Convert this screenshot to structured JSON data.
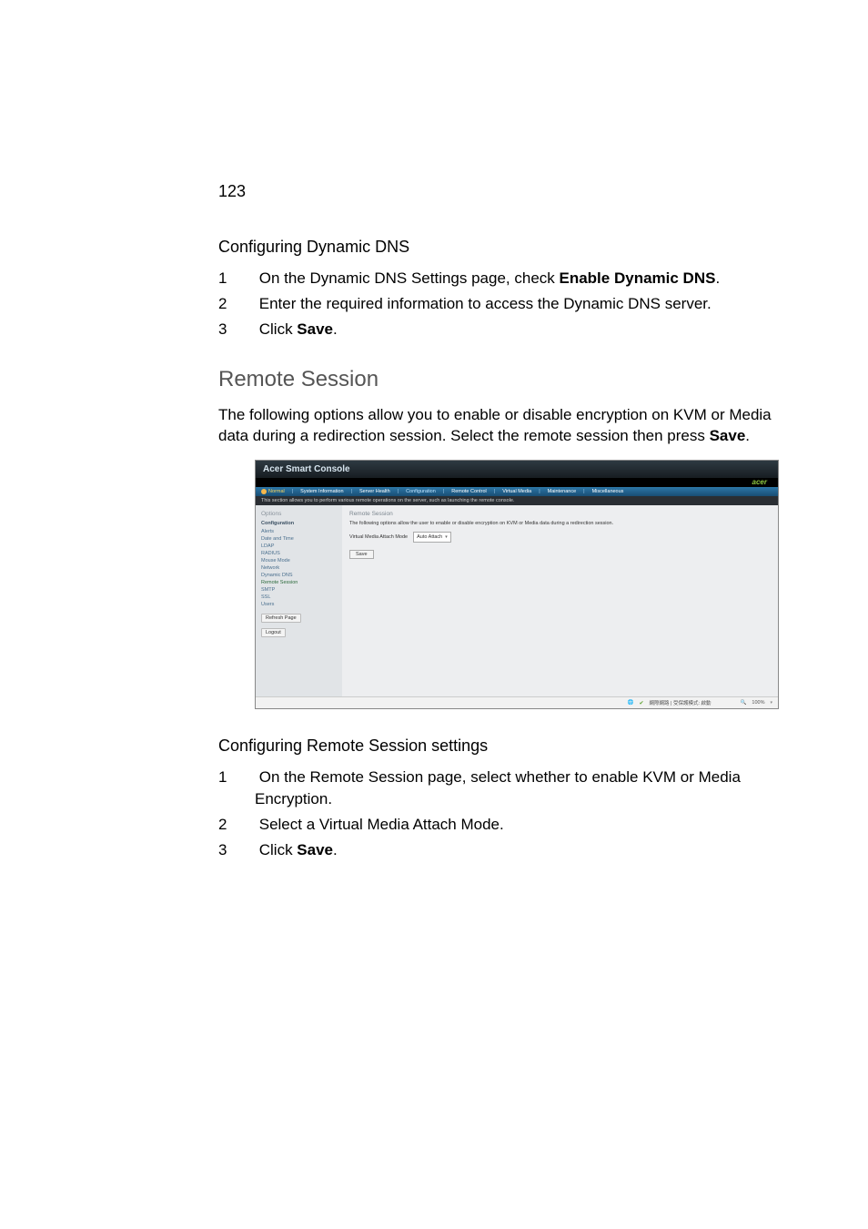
{
  "pageNumber": "123",
  "sectionA": {
    "title": "Configuring Dynamic DNS",
    "steps": {
      "s1_pre": "On the Dynamic DNS Settings page, check ",
      "s1_bold": "Enable Dynamic DNS",
      "s1_post": ".",
      "s2": "Enter the required information to access the Dynamic DNS server.",
      "s3_pre": "Click ",
      "s3_bold": "Save",
      "s3_post": "."
    }
  },
  "sectionB": {
    "title": "Remote Session",
    "intro_pre": "The following options allow you to enable or disable encryption on KVM or Media data during a redirection session. Select the remote session then press ",
    "intro_bold": "Save",
    "intro_post": "."
  },
  "screenshot": {
    "appTitle": "Acer Smart Console",
    "logo": "acer",
    "tabs": {
      "normal": "Normal",
      "sysinfo": "System Information",
      "health": "Server Health",
      "config": "Configuration",
      "remote": "Remote Control",
      "vmedia": "Virtual Media",
      "maint": "Maintenance",
      "misc": "Miscellaneous"
    },
    "desc": "This section allows you to perform various remote operations on the server, such as launching the remote console.",
    "sidebar": {
      "optionsHdr": "Options",
      "catConfig": "Configuration",
      "alerts": "Alerts",
      "datetime": "Date and Time",
      "ldap": "LDAP",
      "radius": "RADIUS",
      "mouse": "Mouse Mode",
      "network": "Network",
      "ddns": "Dynamic DNS",
      "remoteSession": "Remote Session",
      "smtp": "SMTP",
      "ssl": "SSL",
      "users": "Users",
      "refresh": "Refresh Page",
      "logout": "Logout"
    },
    "panel": {
      "title": "Remote Session",
      "desc": "The following options allow the user to enable or disable encryption on KVM or Media data during a redirection session.",
      "fieldLabel": "Virtual Media Attach Mode",
      "selectValue": "Auto Attach",
      "save": "Save"
    },
    "status": {
      "text": "網際網路 | 受保護模式: 啟動",
      "zoom": "100%"
    }
  },
  "sectionC": {
    "title": "Configuring Remote Session settings",
    "steps": {
      "s1": "On the Remote Session page, select whether to enable KVM or Media Encryption.",
      "s2": "Select a Virtual Media Attach Mode.",
      "s3_pre": "Click ",
      "s3_bold": "Save",
      "s3_post": "."
    }
  }
}
